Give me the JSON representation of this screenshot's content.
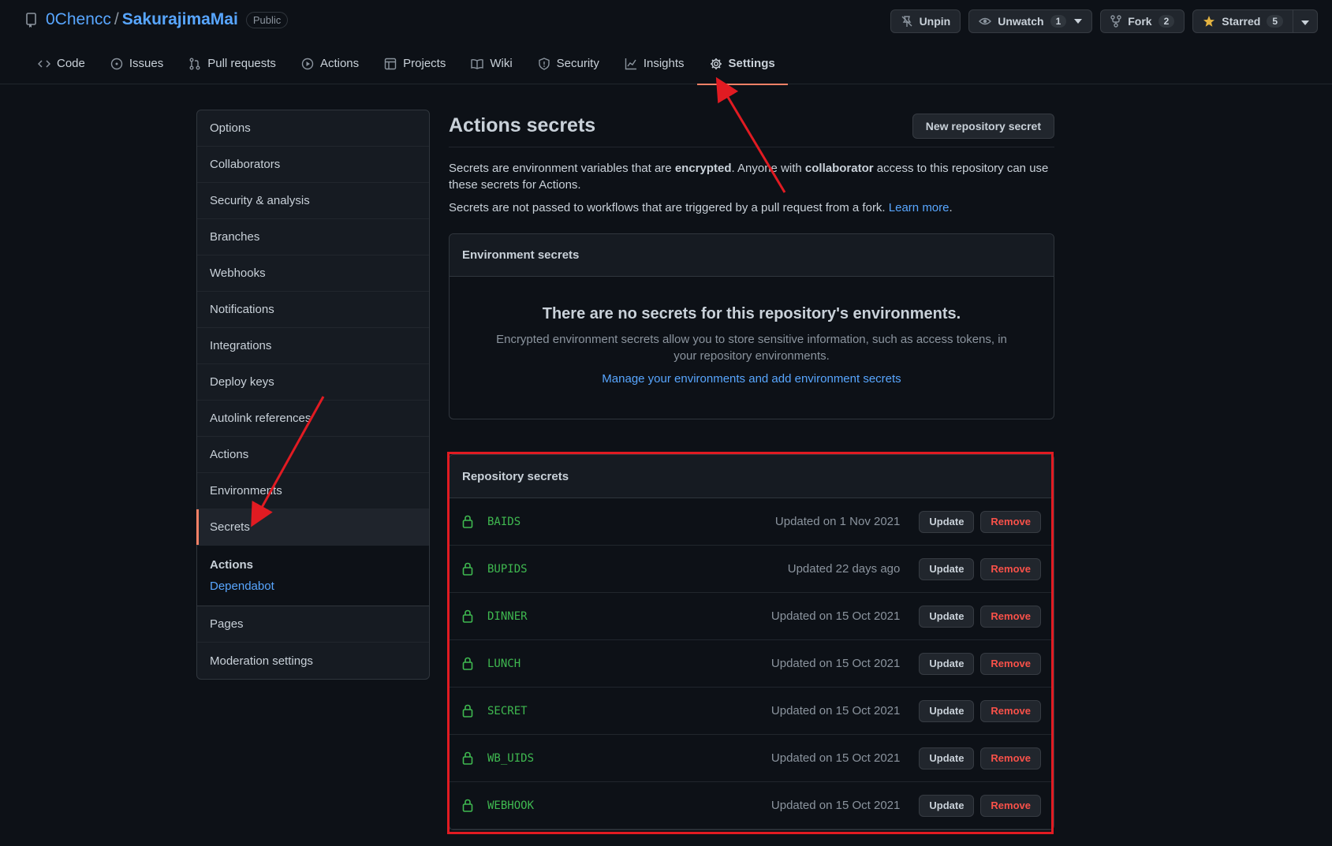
{
  "repo": {
    "owner": "0Chencc",
    "separator": "/",
    "name": "SakurajimaMai",
    "visibility": "Public"
  },
  "header_actions": {
    "unpin": "Unpin",
    "unwatch": "Unwatch",
    "unwatch_count": "1",
    "fork": "Fork",
    "fork_count": "2",
    "starred": "Starred",
    "starred_count": "5"
  },
  "nav_tabs": [
    {
      "label": "Code",
      "icon": "code-icon"
    },
    {
      "label": "Issues",
      "icon": "issue-icon"
    },
    {
      "label": "Pull requests",
      "icon": "pull-request-icon"
    },
    {
      "label": "Actions",
      "icon": "play-icon"
    },
    {
      "label": "Projects",
      "icon": "table-icon"
    },
    {
      "label": "Wiki",
      "icon": "book-icon"
    },
    {
      "label": "Security",
      "icon": "shield-icon"
    },
    {
      "label": "Insights",
      "icon": "graph-icon"
    },
    {
      "label": "Settings",
      "icon": "gear-icon",
      "selected": true
    }
  ],
  "sidebar": {
    "items_top": [
      "Options",
      "Collaborators",
      "Security & analysis",
      "Branches",
      "Webhooks",
      "Notifications",
      "Integrations",
      "Deploy keys",
      "Autolink references",
      "Actions",
      "Environments",
      "Secrets"
    ],
    "selected": "Secrets",
    "sub_heading": "Actions",
    "sub_link": "Dependabot",
    "items_bottom": [
      "Pages",
      "Moderation settings"
    ]
  },
  "main": {
    "title": "Actions secrets",
    "new_button": "New repository secret",
    "desc_1a": "Secrets are environment variables that are ",
    "desc_1b": "encrypted",
    "desc_1c": ". Anyone with ",
    "desc_1d": "collaborator",
    "desc_1e": " access to this repository can use these secrets for Actions.",
    "desc_2": "Secrets are not passed to workflows that are triggered by a pull request from a fork. ",
    "learn_more": "Learn more",
    "period": "."
  },
  "env_secrets": {
    "heading": "Environment secrets",
    "blank_title": "There are no secrets for this repository's environments.",
    "blank_text": "Encrypted environment secrets allow you to store sensitive information, such as access tokens, in your repository environments.",
    "blank_link": "Manage your environments and add environment secrets"
  },
  "repo_secrets": {
    "heading": "Repository secrets",
    "update_label": "Update",
    "remove_label": "Remove",
    "rows": [
      {
        "name": "BAIDS",
        "updated": "Updated on 1 Nov 2021"
      },
      {
        "name": "BUPIDS",
        "updated": "Updated 22 days ago"
      },
      {
        "name": "DINNER",
        "updated": "Updated on 15 Oct 2021"
      },
      {
        "name": "LUNCH",
        "updated": "Updated on 15 Oct 2021"
      },
      {
        "name": "SECRET",
        "updated": "Updated on 15 Oct 2021"
      },
      {
        "name": "WB_UIDS",
        "updated": "Updated on 15 Oct 2021"
      },
      {
        "name": "WEBHOOK",
        "updated": "Updated on 15 Oct 2021"
      }
    ]
  },
  "colors": {
    "background": "#0d1117",
    "link": "#58a6ff",
    "secret_name": "#3fb950",
    "remove": "#f85149",
    "selected_underline": "#f78166",
    "annotation": "#e11b22"
  }
}
